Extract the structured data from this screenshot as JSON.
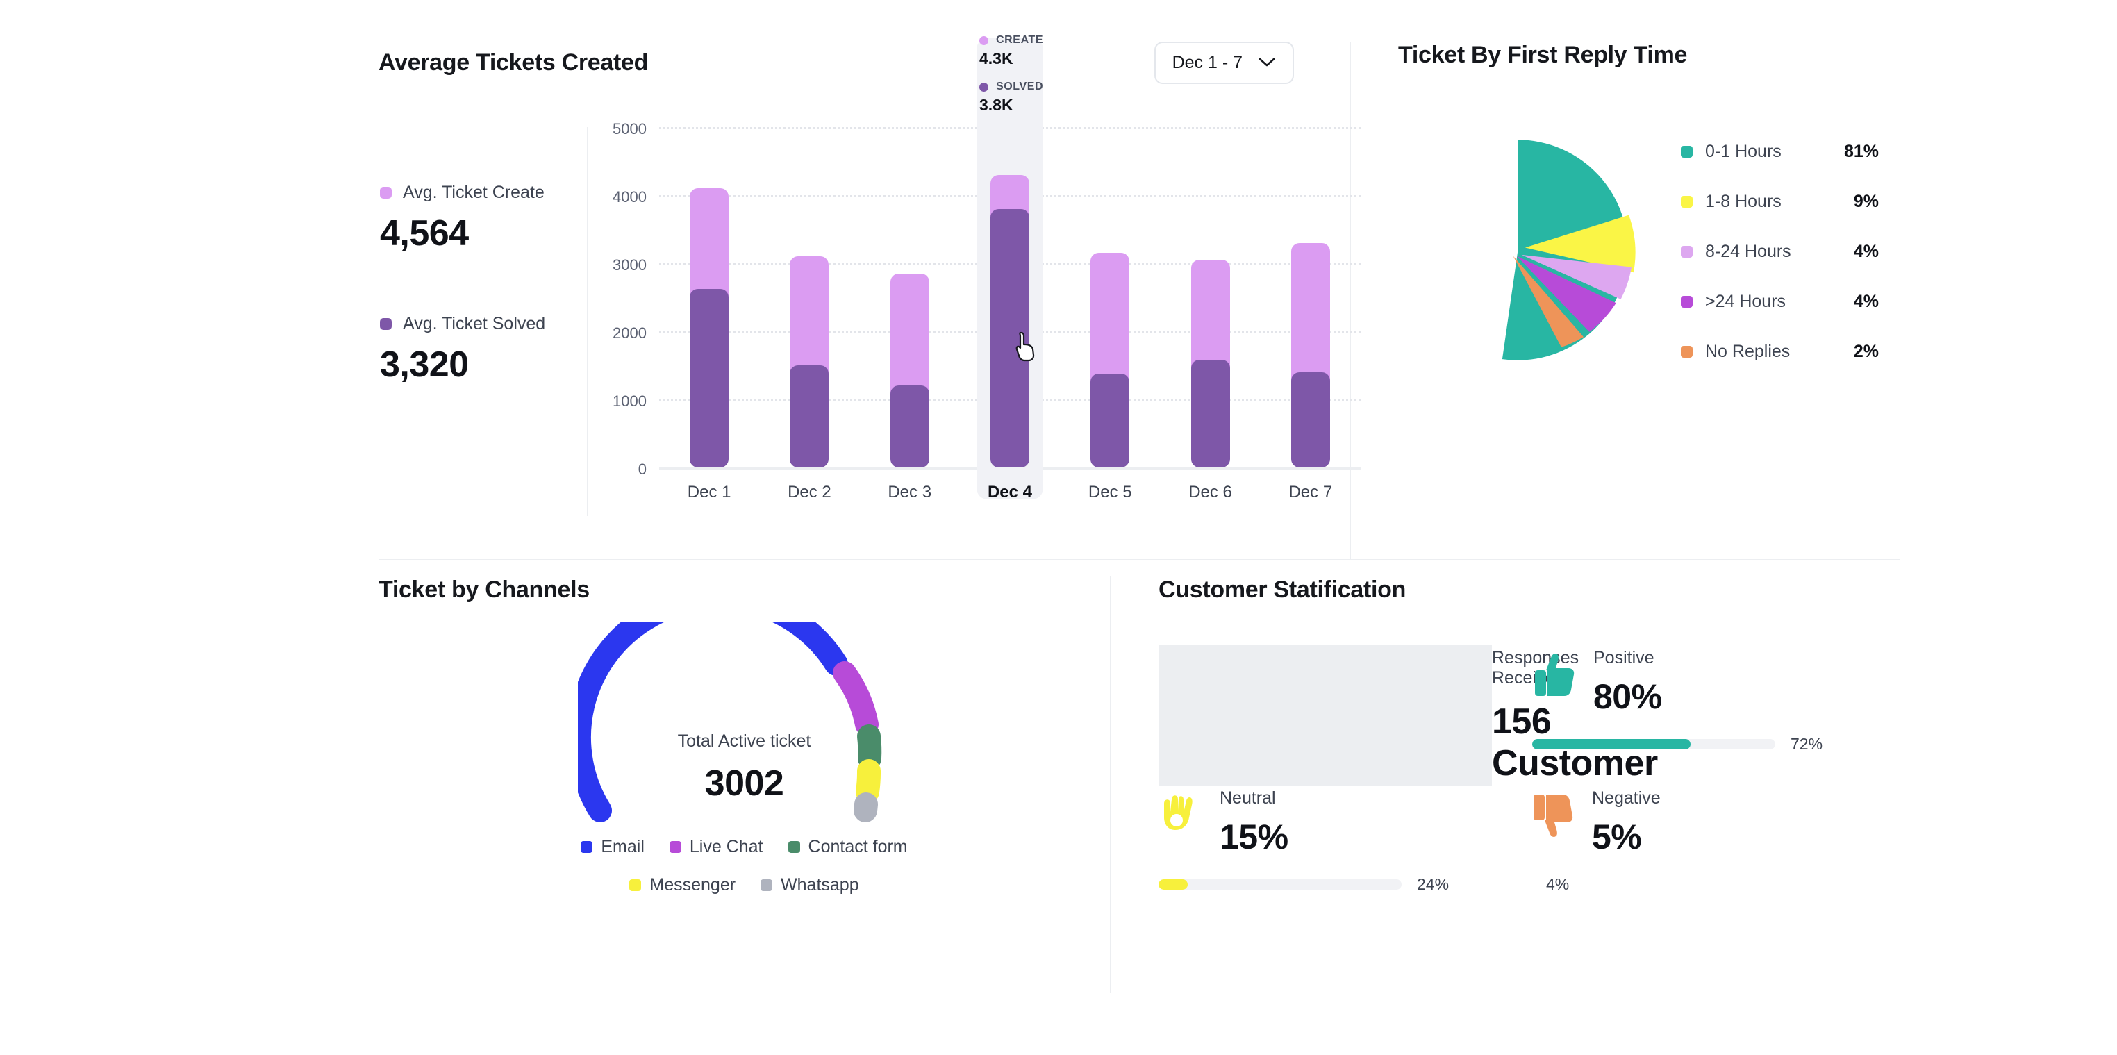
{
  "tickets_created": {
    "title": "Average Tickets Created",
    "date_filter": {
      "value": "Dec 1 - 7",
      "icon": "chevron-down-icon"
    },
    "legend": [
      {
        "label": "Avg. Ticket Create",
        "value": "4,564",
        "color": "#DB9CF2"
      },
      {
        "label": "Avg. Ticket Solved",
        "value": "3,320",
        "color": "#7E57A8"
      }
    ],
    "tooltip": {
      "create_key": "CREATE",
      "create_value": "4.3K",
      "solved_key": "SOLVED",
      "solved_value": "3.8K"
    }
  },
  "reply_time": {
    "title": "Ticket By First Reply Time"
  },
  "channels": {
    "title": "Ticket by Channels",
    "caption": "Total Active ticket",
    "total": "3002",
    "legend_row1": [
      {
        "label": "Email",
        "color": "#2B37EF"
      },
      {
        "label": "Live Chat",
        "color": "#B74BD8"
      },
      {
        "label": "Contact form",
        "color": "#4A8C6A"
      }
    ],
    "legend_row2": [
      {
        "label": "Messenger",
        "color": "#F7F03C"
      },
      {
        "label": "Whatsapp",
        "color": "#AFB3BE"
      }
    ]
  },
  "satisfaction": {
    "title": "Customer Statification",
    "responses_label": "Responses Received",
    "responses_value": "156 Customer",
    "items": [
      {
        "label": "Positive",
        "percent": "80%",
        "bar_caption": "72%",
        "bar_fill": 65,
        "color": "#28B6A3",
        "icon": "thumbs-up-icon"
      },
      {
        "label": "Neutral",
        "percent": "15%",
        "bar_caption": "24%",
        "bar_fill": 12,
        "color": "#F7F03C",
        "icon": "ok-hand-icon"
      },
      {
        "label": "Negative",
        "percent": "5%",
        "bar_caption": "4%",
        "bar_fill": 4,
        "color": "#EB6D28",
        "icon": "thumbs-down-icon"
      }
    ]
  },
  "chart_data": [
    {
      "type": "bar",
      "title": "Average Tickets Created",
      "xlabel": "",
      "ylabel": "",
      "categories": [
        "Dec 1",
        "Dec 2",
        "Dec 3",
        "Dec 4",
        "Dec 5",
        "Dec 6",
        "Dec 7"
      ],
      "yticks": [
        "0",
        "1000",
        "2000",
        "3000",
        "4000",
        "5000"
      ],
      "ylim": [
        0,
        5000
      ],
      "grid": true,
      "stacked": true,
      "highlighted_category": "Dec 4",
      "legend_position": "left",
      "series": [
        {
          "name": "Avg. Ticket Create",
          "color": "#DB9CF2",
          "values": [
            4100,
            3100,
            2850,
            4300,
            3150,
            3050,
            3300
          ]
        },
        {
          "name": "Avg. Ticket Solved",
          "color": "#7E57A8",
          "values": [
            2620,
            1500,
            1200,
            3800,
            1380,
            1580,
            1400
          ]
        }
      ]
    },
    {
      "type": "pie",
      "title": "Ticket By First Reply Time",
      "legend_position": "right",
      "labels": [
        "0-1 Hours",
        "1-8 Hours",
        "8-24 Hours",
        ">24 Hours",
        "No Replies"
      ],
      "values": [
        81,
        9,
        4,
        4,
        2
      ],
      "display_values": [
        "81%",
        "9%",
        "4%",
        "4%",
        "2%"
      ],
      "colors": [
        "#28B6A3",
        "#FAF546",
        "#DDA7F0",
        "#B74BD8",
        "#EE9459"
      ]
    },
    {
      "type": "pie",
      "subtype": "gauge",
      "title": "Ticket by Channels",
      "center_label": "Total Active ticket",
      "center_value": "3002",
      "legend_position": "bottom",
      "labels": [
        "Email",
        "Live Chat",
        "Contact form",
        "Messenger",
        "Whatsapp"
      ],
      "values": [
        62,
        17,
        8,
        8,
        5
      ],
      "colors": [
        "#2B37EF",
        "#B74BD8",
        "#4A8C6A",
        "#F7F03C",
        "#AFB3BE"
      ]
    },
    {
      "type": "bar",
      "subtype": "progress",
      "title": "Customer Statification",
      "categories": [
        "Positive",
        "Neutral",
        "Negative"
      ],
      "values": [
        80,
        15,
        5
      ],
      "display_values": [
        "80%",
        "15%",
        "5%"
      ],
      "secondary_values": [
        72,
        24,
        4
      ],
      "secondary_display": [
        "72%",
        "24%",
        "4%"
      ],
      "colors": [
        "#28B6A3",
        "#F7F03C",
        "#EB6D28"
      ],
      "ylim": [
        0,
        100
      ]
    }
  ]
}
